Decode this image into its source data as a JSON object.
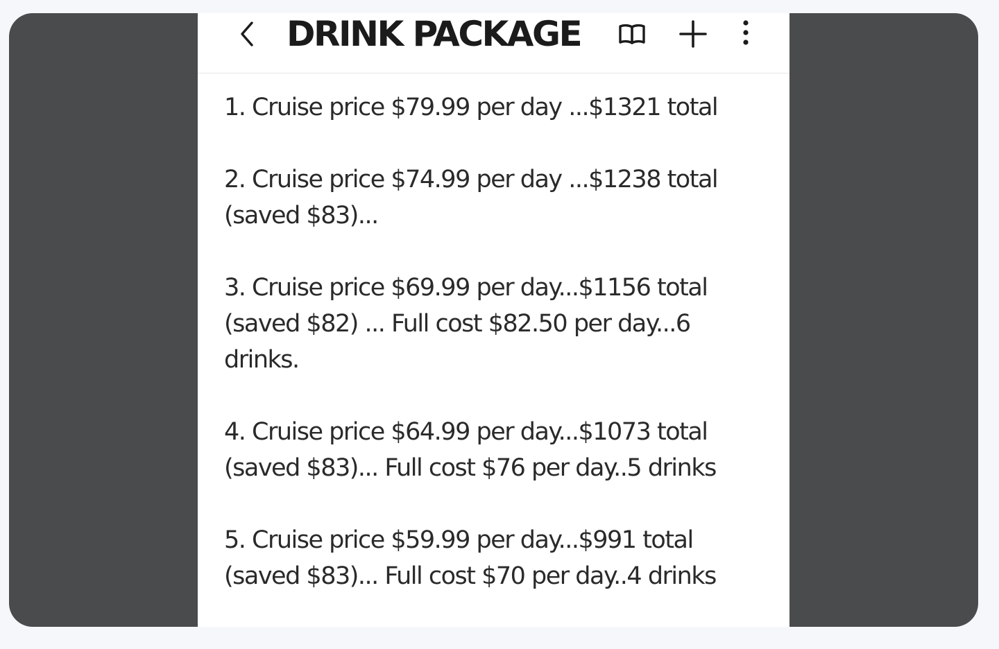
{
  "note": {
    "title": "DRINK PACKAGE",
    "items": [
      "1. Cruise price $79.99 per day ...$1321 total",
      "2. Cruise price $74.99 per day ...$1238 total (saved $83)...",
      "3. Cruise price $69.99 per day...$1156 total (saved $82) ... Full cost $82.50 per day...6 drinks.",
      "4. Cruise price $64.99 per day...$1073 total (saved $83)... Full cost $76 per day..5 drinks",
      "5. Cruise price $59.99 per day...$991 total (saved $83)... Full cost $70 per day..4 drinks"
    ]
  },
  "toolbar": {
    "back_icon": "chevron-left-icon",
    "reader_icon": "open-book-icon",
    "add_icon": "plus-icon",
    "more_icon": "more-vertical-icon"
  },
  "colors": {
    "backdrop": "#4a4b4c",
    "page": "#ffffff",
    "text": "#2a2a2a",
    "title": "#1b1b1b"
  }
}
